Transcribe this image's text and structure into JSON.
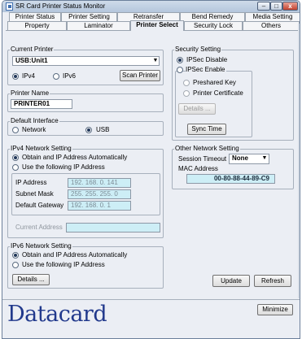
{
  "window": {
    "title": "SR Card Printer Status Monitor",
    "min_glyph": "–",
    "max_glyph": "□",
    "close_glyph": "x"
  },
  "tabs_row1": [
    "Printer Status",
    "Printer Setting",
    "Retransfer",
    "Bend Remedy",
    "Media Setting"
  ],
  "tabs_row2": [
    "Property",
    "Laminator",
    "Printer Select",
    "Security Lock",
    "Others"
  ],
  "current_printer": {
    "title": "Current Printer",
    "value": "USB:Unit1",
    "ipv4": "IPv4",
    "ipv6": "IPv6",
    "scan": "Scan Printer",
    "selected": "IPv4"
  },
  "printer_name": {
    "title": "Printer Name",
    "value": "PRINTER01"
  },
  "default_interface": {
    "title": "Default Interface",
    "network": "Network",
    "usb": "USB",
    "selected": "USB"
  },
  "ipv4": {
    "title": "IPv4 Network Setting",
    "auto": "Obtain and IP Address Automatically",
    "manual": "Use the following IP Address",
    "ip_label": "IP Address",
    "ip_value": "192. 168. 0. 141",
    "mask_label": "Subnet Mask",
    "mask_value": "255. 255. 255. 0",
    "gw_label": "Default Gateway",
    "gw_value": "192. 168. 0. 1",
    "current_label": "Current Address",
    "current_value": ""
  },
  "ipv6": {
    "title": "IPv6 Network Setting",
    "auto": "Obtain and IP Address Automatically",
    "manual": "Use the following IP Address",
    "details": "Details ..."
  },
  "security": {
    "title": "Security Setting",
    "disable": "IPSec Disable",
    "enable_title": "IPSec Enable",
    "preshared": "Preshared Key",
    "certificate": "Printer Certificate",
    "details": "Details ..."
  },
  "sync_time": "Sync Time",
  "other_network": {
    "title": "Other Network Setting",
    "timeout_label": "Session Timeout",
    "timeout_value": "None",
    "mac_label": "MAC Address",
    "mac_value": "00-80-88-44-89-C9"
  },
  "buttons": {
    "update": "Update",
    "refresh": "Refresh",
    "minimize": "Minimize"
  },
  "brand": {
    "logo": "Datacard"
  },
  "colors": {
    "logo": "#21398c",
    "field_blue": "#cdeef6",
    "window_bg": "#ebeef4"
  }
}
